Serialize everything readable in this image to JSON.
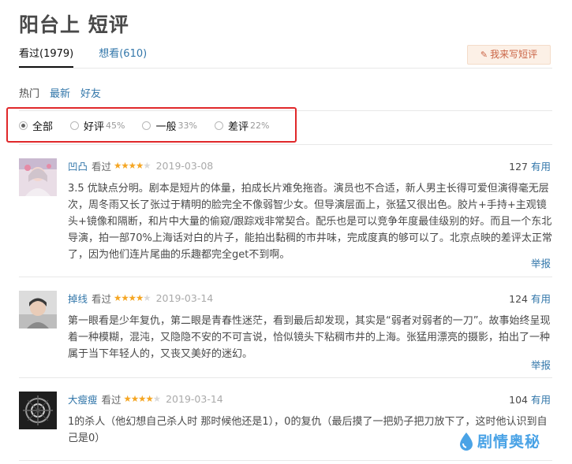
{
  "page": {
    "title": "阳台上 短评"
  },
  "tabs": [
    {
      "label": "看过(1979)",
      "active": true
    },
    {
      "label": "想看(610)",
      "active": false
    }
  ],
  "write_button": {
    "label": "我来写短评",
    "icon": "pen-icon"
  },
  "sorts": [
    {
      "label": "热门",
      "active": true
    },
    {
      "label": "最新",
      "active": false
    },
    {
      "label": "好友",
      "active": false
    }
  ],
  "filters": [
    {
      "label": "全部",
      "percent": "",
      "checked": true
    },
    {
      "label": "好评",
      "percent": "45%",
      "checked": false
    },
    {
      "label": "一般",
      "percent": "33%",
      "checked": false
    },
    {
      "label": "差评",
      "percent": "22%",
      "checked": false
    }
  ],
  "comments": [
    {
      "user": "凹凸",
      "status": "看过",
      "rating": 4,
      "date": "2019-03-08",
      "votes": "127",
      "useful_label": "有用",
      "lines": [
        "3.5 优缺点分明。剧本是短片的体量，拍成长片难免拖沓。演员也不合适，新人男主长得可爱但演得毫无层",
        "次，周冬雨又长了张过于精明的脸完全不像弱智少女。但导演层面上，张猛又很出色。胶片+手持+主观镜",
        "头+镜像和隔断，和片中大量的偷窥/跟踪戏非常契合。配乐也是可以竞争年度最佳级别的好。而且一个东北",
        "导演，拍一部70%上海话对白的片子，能拍出黏稠的市井味，完成度真的够可以了。北京点映的差评太正常",
        "了，因为他们连片尾曲的乐趣都完全get不到啊。"
      ],
      "report_label": "举报"
    },
    {
      "user": "掉线",
      "status": "看过",
      "rating": 4,
      "date": "2019-03-14",
      "votes": "124",
      "useful_label": "有用",
      "lines": [
        "第一眼看是少年复仇，第二眼是青春性迷茫，看到最后却发现，其实是“弱者对弱者的一刀”。故事始终呈现",
        "着一种模糊，混沌，又隐隐不安的不可言说，恰似镜头下粘稠市井的上海。张猛用漂亮的摄影，拍出了一种",
        "属于当下年轻人的，又丧又美好的迷幻。"
      ],
      "report_label": "举报"
    },
    {
      "user": "大瘦瘦",
      "status": "看过",
      "rating": 4,
      "date": "2019-03-14",
      "votes": "104",
      "useful_label": "有用",
      "lines": [
        "1的杀人（他幻想自己杀人时 那时候他还是1），0的复仇（最后摸了一把奶子把刀放下了，这时他认识到自",
        "己是0）"
      ],
      "report_label": ""
    }
  ],
  "watermark": {
    "text": "剧情奥秘"
  },
  "colors": {
    "link": "#3377aa",
    "star": "#f5a623",
    "highlight": "#e0282a",
    "button_bg": "#fcf0e6",
    "button_text": "#ca6445"
  }
}
